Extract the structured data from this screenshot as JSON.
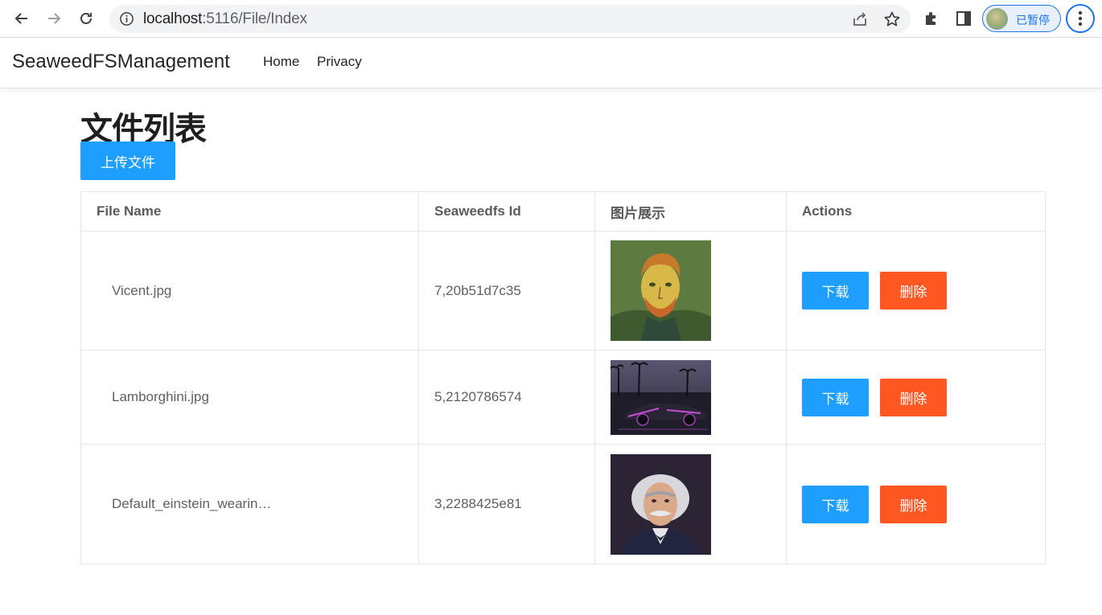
{
  "browser": {
    "url_host": "localhost",
    "url_rest": ":5116/File/Index",
    "profile_label": "已暂停"
  },
  "navbar": {
    "brand": "SeaweedFSManagement",
    "links": [
      "Home",
      "Privacy"
    ]
  },
  "page": {
    "title": "文件列表",
    "upload_label": "上传文件"
  },
  "table": {
    "headers": [
      "File Name",
      "Seaweedfs Id",
      "图片展示",
      "Actions"
    ],
    "rows": [
      {
        "file_name": "Vicent.jpg",
        "id": "7,20b51d7c35",
        "image": "van-gogh-portrait"
      },
      {
        "file_name": "Lamborghini.jpg",
        "id": "5,2120786574",
        "image": "lamborghini-night"
      },
      {
        "file_name": "Default_einstein_wearin…",
        "id": "3,2288425e81",
        "image": "einstein-portrait"
      }
    ],
    "download_label": "下载",
    "delete_label": "删除"
  },
  "colors": {
    "primary_button": "#1e9fff",
    "danger_button": "#ff5722"
  }
}
